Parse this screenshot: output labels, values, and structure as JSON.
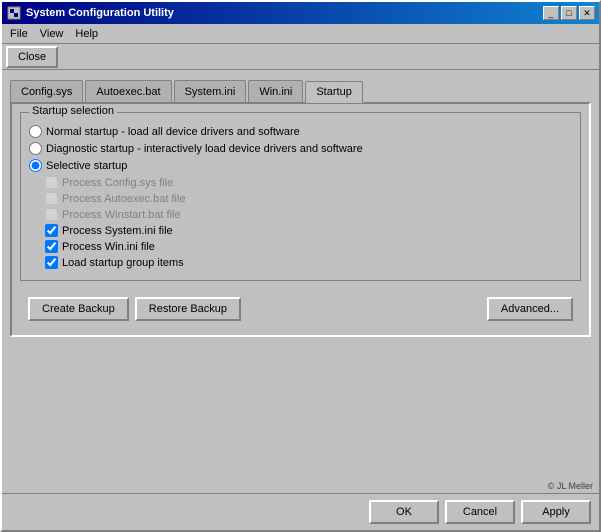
{
  "titlebar": {
    "title": "System Configuration Utility",
    "minimize_label": "_",
    "maximize_label": "□",
    "close_label": "✕"
  },
  "menubar": {
    "items": [
      {
        "label": "File"
      },
      {
        "label": "View"
      },
      {
        "label": "Help"
      }
    ]
  },
  "toolbar": {
    "close_label": "Close"
  },
  "tabs": [
    {
      "label": "Config.sys",
      "active": false
    },
    {
      "label": "Autoexec.bat",
      "active": false
    },
    {
      "label": "System.ini",
      "active": false
    },
    {
      "label": "Win.ini",
      "active": false
    },
    {
      "label": "Startup",
      "active": true
    }
  ],
  "startup_selection": {
    "group_label": "Startup selection",
    "radio_options": [
      {
        "label": "Normal startup - load all device drivers and software",
        "value": "normal",
        "checked": false
      },
      {
        "label": "Diagnostic startup - interactively load device drivers and software",
        "value": "diagnostic",
        "checked": false
      },
      {
        "label": "Selective startup",
        "value": "selective",
        "checked": true
      }
    ],
    "checkboxes": [
      {
        "label": "Process Config.sys file",
        "checked": false,
        "enabled": false
      },
      {
        "label": "Process Autoexec.bat file",
        "checked": false,
        "enabled": false
      },
      {
        "label": "Process Winstart.bat file",
        "checked": false,
        "enabled": false
      },
      {
        "label": "Process System.ini file",
        "checked": true,
        "enabled": true
      },
      {
        "label": "Process Win.ini file",
        "checked": true,
        "enabled": true
      },
      {
        "label": "Load startup group items",
        "checked": true,
        "enabled": true
      }
    ]
  },
  "action_buttons": {
    "create_backup": "Create Backup",
    "restore_backup": "Restore Backup",
    "advanced": "Advanced..."
  },
  "bottom_buttons": {
    "ok": "OK",
    "cancel": "Cancel",
    "apply": "Apply"
  },
  "copyright": "© JL Meller"
}
